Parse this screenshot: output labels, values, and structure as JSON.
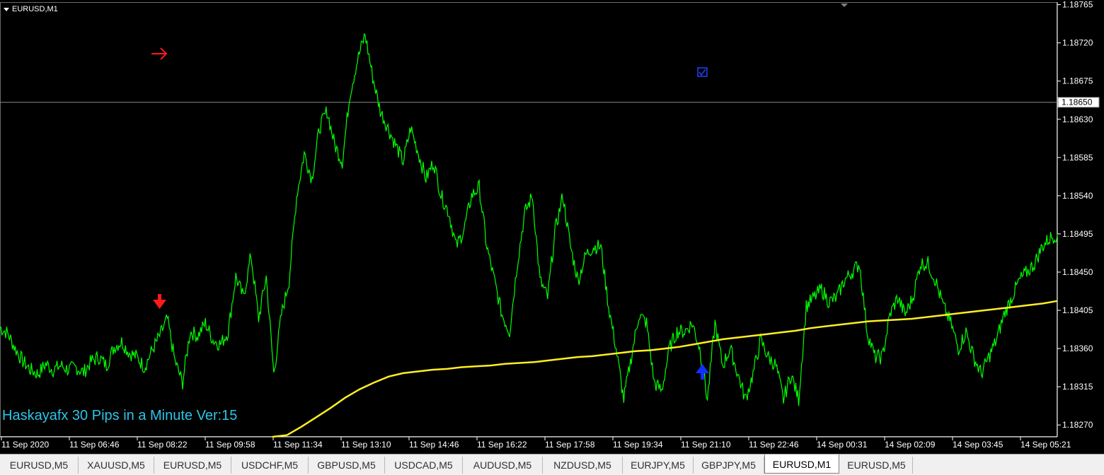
{
  "window": {
    "symbol_label": "EURUSD,M1"
  },
  "indicator": {
    "title": "Haskayafx 30 Pips in a Minute Ver:15"
  },
  "colors": {
    "background": "#000000",
    "price": "#00ff00",
    "ma": "#ffee22",
    "grid": "#ffffff",
    "sell_signal": "#ff1a1a",
    "buy_signal": "#1030ff"
  },
  "icons": {
    "down_arrow": "down-arrow-icon",
    "right_arrow": "right-arrow-icon",
    "up_arrow": "up-arrow-icon",
    "checkbox": "checkbox-icon"
  },
  "tabs": [
    {
      "label": "EURUSD,M5",
      "active": false
    },
    {
      "label": "XAUUSD,M5",
      "active": false
    },
    {
      "label": "EURUSD,M5",
      "active": false
    },
    {
      "label": "USDCHF,M5",
      "active": false
    },
    {
      "label": "GBPUSD,M5",
      "active": false
    },
    {
      "label": "USDCAD,M5",
      "active": false
    },
    {
      "label": "AUDUSD,M5",
      "active": false
    },
    {
      "label": "NZDUSD,M5",
      "active": false
    },
    {
      "label": "EURJPY,M5",
      "active": false
    },
    {
      "label": "GBPJPY,M5",
      "active": false
    },
    {
      "label": "EURUSD,M1",
      "active": true
    },
    {
      "label": "EURUSD,M5",
      "active": false
    }
  ],
  "chart_data": {
    "type": "line",
    "ylim": [
      1.18256,
      1.18768
    ],
    "y_ticks": [
      "1.18765",
      "1.18720",
      "1.18675",
      "1.18630",
      "1.18585",
      "1.18540",
      "1.18495",
      "1.18450",
      "1.18405",
      "1.18360",
      "1.18315",
      "1.18270"
    ],
    "x_ticks": [
      "11 Sep 2020",
      "11 Sep 06:46",
      "11 Sep 08:22",
      "11 Sep 09:58",
      "11 Sep 11:34",
      "11 Sep 13:10",
      "11 Sep 14:46",
      "11 Sep 16:22",
      "11 Sep 17:58",
      "11 Sep 19:34",
      "11 Sep 21:10",
      "11 Sep 22:46",
      "14 Sep 00:31",
      "14 Sep 02:09",
      "14 Sep 03:45",
      "14 Sep 05:21"
    ],
    "current_price": "1.18650",
    "series": [
      {
        "values": [
          1.18385,
          1.18378,
          1.1836,
          1.18345,
          1.18335,
          1.1833,
          1.18342,
          1.18335,
          1.1834,
          1.18335,
          1.18338,
          1.18332,
          1.18345,
          1.1835,
          1.1834,
          1.18362,
          1.18368,
          1.18355,
          1.1835,
          1.18338,
          1.18358,
          1.18375,
          1.18395,
          1.18345,
          1.1832,
          1.1838,
          1.18375,
          1.1839,
          1.1837,
          1.18365,
          1.1838,
          1.18445,
          1.1842,
          1.1847,
          1.18395,
          1.18445,
          1.1833,
          1.184,
          1.1844,
          1.1854,
          1.1859,
          1.1856,
          1.1862,
          1.1864,
          1.186,
          1.1858,
          1.1866,
          1.187,
          1.1873,
          1.1868,
          1.1864,
          1.1862,
          1.186,
          1.1858,
          1.1862,
          1.1859,
          1.1856,
          1.1858,
          1.1854,
          1.1852,
          1.1848,
          1.185,
          1.1854,
          1.1855,
          1.1848,
          1.1844,
          1.184,
          1.1838,
          1.1846,
          1.1852,
          1.1854,
          1.1844,
          1.1842,
          1.185,
          1.1854,
          1.1848,
          1.1844,
          1.1847,
          1.1848,
          1.1848,
          1.1841,
          1.1836,
          1.183,
          1.1835,
          1.184,
          1.1839,
          1.1832,
          1.1831,
          1.1836,
          1.1838,
          1.1838,
          1.1839,
          1.1836,
          1.183,
          1.1839,
          1.1834,
          1.1836,
          1.1833,
          1.183,
          1.1833,
          1.1837,
          1.1835,
          1.1834,
          1.183,
          1.1833,
          1.183,
          1.1841,
          1.1842,
          1.1843,
          1.18415,
          1.1842,
          1.1844,
          1.1845,
          1.1846,
          1.1838,
          1.1835,
          1.1835,
          1.184,
          1.1842,
          1.184,
          1.1842,
          1.1846,
          1.1846,
          1.1844,
          1.1841,
          1.1839,
          1.1836,
          1.1838,
          1.1835,
          1.1833,
          1.1835,
          1.1837,
          1.184,
          1.1842,
          1.1844,
          1.1845,
          1.1846,
          1.1848,
          1.1849,
          1.18495
        ]
      },
      {
        "values": [
          1.1825,
          1.18258,
          1.18268,
          1.18279,
          1.1829,
          1.18302,
          1.18312,
          1.1832,
          1.18327,
          1.18331,
          1.18333,
          1.18335,
          1.18336,
          1.18338,
          1.18339,
          1.1834,
          1.18342,
          1.18343,
          1.18344,
          1.18346,
          1.18348,
          1.1835,
          1.18351,
          1.18353,
          1.18355,
          1.18357,
          1.18358,
          1.1836,
          1.18362,
          1.18365,
          1.18368,
          1.18371,
          1.18373,
          1.18375,
          1.18377,
          1.18379,
          1.18381,
          1.18384,
          1.18386,
          1.18388,
          1.1839,
          1.18392,
          1.18393,
          1.18394,
          1.18395,
          1.18397,
          1.18399,
          1.18401,
          1.18403,
          1.18405,
          1.18407,
          1.18409,
          1.18411,
          1.18413,
          1.18416
        ]
      }
    ]
  }
}
